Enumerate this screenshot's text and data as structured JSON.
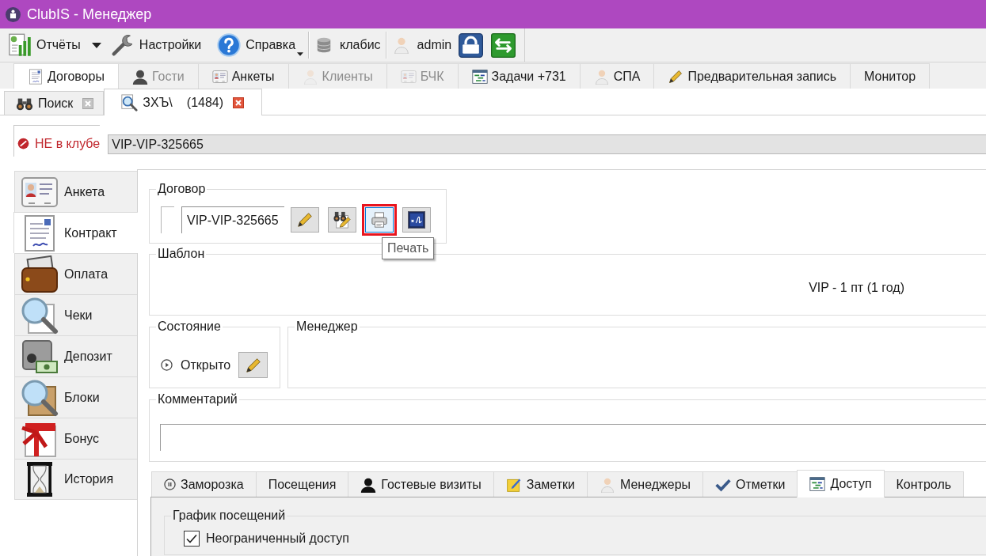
{
  "window": {
    "title": "ClubIS - Менеджер"
  },
  "toolbar": [
    {
      "kind": "split",
      "label": "Отчёты"
    },
    {
      "kind": "button",
      "label": "Настройки"
    },
    {
      "kind": "menu",
      "label": "Справка"
    },
    {
      "kind": "separator"
    },
    {
      "kind": "button",
      "label": "клабис"
    },
    {
      "kind": "separator"
    },
    {
      "kind": "button",
      "label": "admin"
    },
    {
      "kind": "icon"
    },
    {
      "kind": "icon"
    }
  ],
  "main_tabs": [
    {
      "label": "Договоры",
      "selected": true,
      "disabled": false
    },
    {
      "label": "Гости",
      "selected": false,
      "disabled": true
    },
    {
      "label": "Анкеты",
      "selected": false,
      "disabled": false
    },
    {
      "label": "Клиенты",
      "selected": false,
      "disabled": true
    },
    {
      "label": "БЧК",
      "selected": false,
      "disabled": true
    },
    {
      "label": "Задачи +731",
      "selected": false,
      "disabled": false
    },
    {
      "label": "СПА",
      "selected": false,
      "disabled": false
    },
    {
      "label": "Предварительная запись",
      "selected": false,
      "disabled": false
    },
    {
      "label": "Монитор",
      "selected": false,
      "disabled": false
    }
  ],
  "document_tabs": [
    {
      "label": "Поиск",
      "selected": false
    },
    {
      "label": "ЗХЪ\\",
      "count": "(1484)",
      "selected": true
    }
  ],
  "client_status": {
    "label": "НЕ в клубе",
    "value": "VIP-VIP-325665"
  },
  "sidebar": {
    "items": [
      {
        "label": "Анкета",
        "selected": false
      },
      {
        "label": "Контракт",
        "selected": true
      },
      {
        "label": "Оплата",
        "selected": false
      },
      {
        "label": "Чеки",
        "selected": false
      },
      {
        "label": "Депозит",
        "selected": false
      },
      {
        "label": "Блоки",
        "selected": false
      },
      {
        "label": "Бонус",
        "selected": false
      },
      {
        "label": "История",
        "selected": false
      }
    ]
  },
  "contract": {
    "title": "Договор",
    "number": "VIP-VIP-325665",
    "buttons": [
      {
        "highlighted": false,
        "hovered": false
      },
      {
        "highlighted": false,
        "hovered": false
      },
      {
        "highlighted": true,
        "hovered": true,
        "tooltip": "Печать"
      },
      {
        "highlighted": false,
        "hovered": false
      }
    ]
  },
  "template": {
    "title": "Шаблон",
    "value": "VIP - 1 пт (1 год)"
  },
  "state": {
    "title": "Состояние",
    "value": "Открыто"
  },
  "manager": {
    "title": "Менеджер"
  },
  "comment": {
    "title": "Комментарий"
  },
  "bottom_tabs": [
    {
      "label": "Заморозка",
      "selected": false
    },
    {
      "label": "Посещения",
      "selected": false
    },
    {
      "label": "Гостевые визиты",
      "selected": false
    },
    {
      "label": "Заметки",
      "selected": false
    },
    {
      "label": "Менеджеры",
      "selected": false
    },
    {
      "label": "Отметки",
      "selected": false
    },
    {
      "label": "Доступ",
      "selected": true
    },
    {
      "label": "Контроль",
      "selected": false
    }
  ],
  "access_panel": {
    "group_title": "График посещений",
    "checkbox": {
      "label": "Неограниченный доступ",
      "checked": true
    }
  }
}
